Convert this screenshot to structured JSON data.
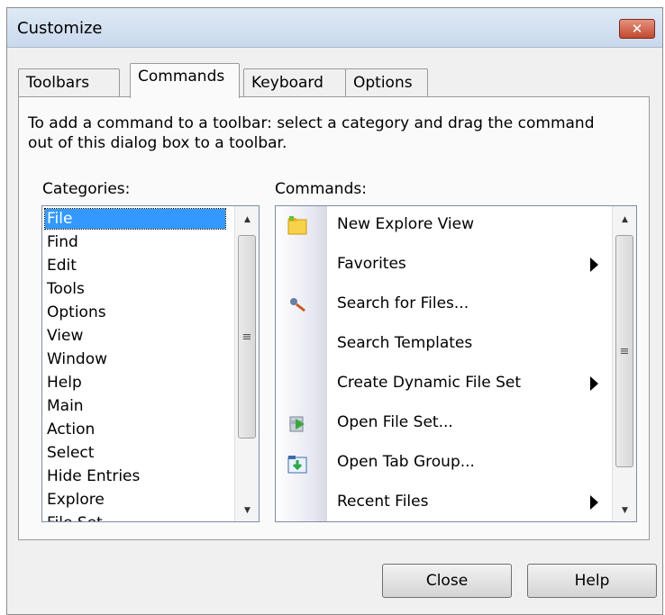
{
  "window": {
    "title": "Customize",
    "close_label": "✕"
  },
  "tabs": [
    {
      "label": "Toolbars",
      "active": false
    },
    {
      "label": "Commands",
      "active": true
    },
    {
      "label": "Keyboard",
      "active": false
    },
    {
      "label": "Options",
      "active": false
    }
  ],
  "description": "To add a command to a toolbar: select a category and drag the command out of this dialog box to a toolbar.",
  "categories": {
    "label": "Categories:",
    "selected": "File",
    "items": [
      "File",
      "Find",
      "Edit",
      "Tools",
      "Options",
      "View",
      "Window",
      "Help",
      "Main",
      "Action",
      "Select",
      "Hide Entries",
      "Explore",
      "File Set"
    ]
  },
  "commands": {
    "label": "Commands:",
    "items": [
      {
        "label": "New Explore View",
        "icon": "folder-icon",
        "submenu": false
      },
      {
        "label": "Favorites",
        "icon": "",
        "submenu": true
      },
      {
        "label": "Search for Files...",
        "icon": "magnifier-icon",
        "submenu": false
      },
      {
        "label": "Search Templates",
        "icon": "",
        "submenu": false
      },
      {
        "label": "Create Dynamic File Set",
        "icon": "",
        "submenu": true
      },
      {
        "label": "Open File Set...",
        "icon": "file-set-icon",
        "submenu": false
      },
      {
        "label": "Open Tab Group...",
        "icon": "tab-group-icon",
        "submenu": false
      },
      {
        "label": "Recent Files",
        "icon": "",
        "submenu": true
      }
    ]
  },
  "buttons": {
    "close": "Close",
    "help": "Help"
  },
  "colors": {
    "selection": "#3399ff",
    "close_x": "#c14a30"
  }
}
